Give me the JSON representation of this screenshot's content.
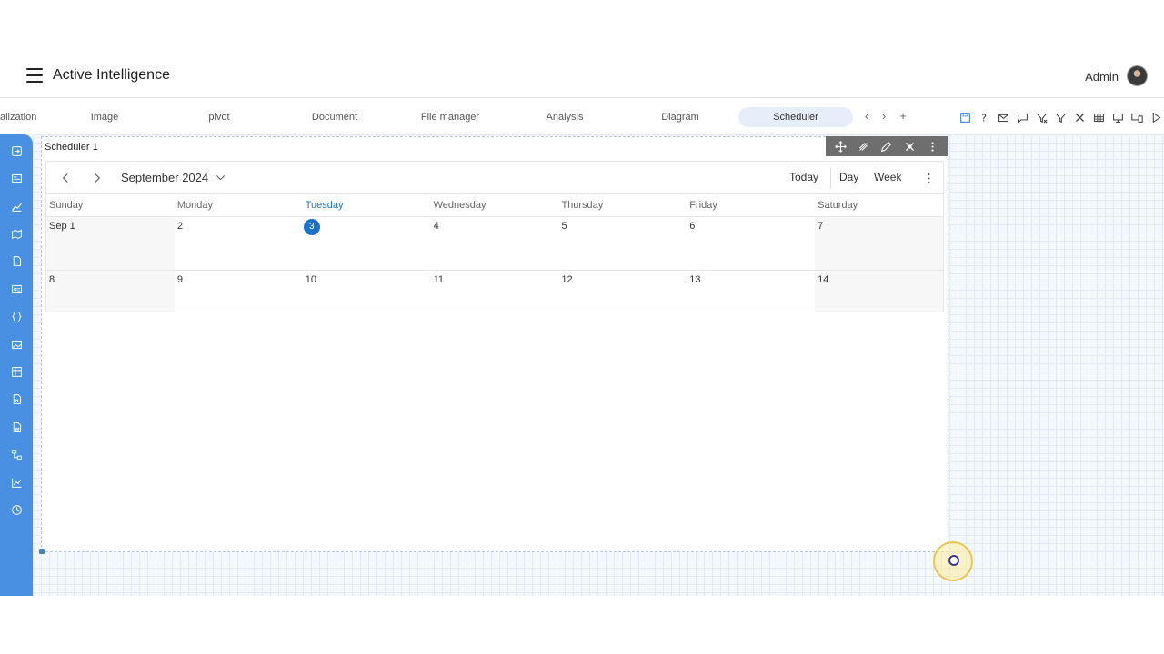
{
  "header": {
    "app_title": "Active Intelligence",
    "user_name": "Admin",
    "menu_icon": "hamburger-menu-icon",
    "avatar_icon": "user-avatar"
  },
  "tabs": [
    {
      "label": "alization",
      "active": false
    },
    {
      "label": "Image",
      "active": false
    },
    {
      "label": "pivot",
      "active": false
    },
    {
      "label": "Document",
      "active": false
    },
    {
      "label": "File manager",
      "active": false
    },
    {
      "label": "Analysis",
      "active": false
    },
    {
      "label": "Diagram",
      "active": false
    },
    {
      "label": "Scheduler",
      "active": true
    }
  ],
  "tab_controls": {
    "prev_icon": "chevron-left-icon",
    "next_icon": "chevron-right-icon",
    "add_icon": "plus-icon"
  },
  "toolbar_icons": [
    "save-icon",
    "help-icon",
    "mail-icon",
    "comment-icon",
    "clear-filter-icon",
    "filter-icon",
    "tools-icon",
    "table-icon",
    "screen-icon",
    "devices-icon",
    "play-icon"
  ],
  "sidebar_icons": [
    "login-icon",
    "news-icon",
    "chart-icon",
    "map-icon",
    "document-icon",
    "id-card-icon",
    "code-braces-icon",
    "image-icon",
    "pivot-icon",
    "excel-icon",
    "word-icon",
    "diagram-icon",
    "analysis-icon",
    "scheduler-icon"
  ],
  "widget": {
    "title": "Scheduler 1",
    "tool_icons": [
      "move-icon",
      "link-icon",
      "edit-icon",
      "settings-icon",
      "more-vertical-icon"
    ]
  },
  "scheduler": {
    "date_range": "September 2024",
    "views": {
      "today": "Today",
      "day": "Day",
      "week": "Week"
    },
    "day_names": [
      "Sunday",
      "Monday",
      "Tuesday",
      "Wednesday",
      "Thursday",
      "Friday",
      "Saturday"
    ],
    "today_index": 2,
    "weeks": [
      [
        "Sep 1",
        "2",
        "3",
        "4",
        "5",
        "6",
        "7"
      ],
      [
        "8",
        "9",
        "10",
        "11",
        "12",
        "13",
        "14"
      ]
    ]
  },
  "colors": {
    "accent": "#1a73c8",
    "sidebar": "#4a90e2",
    "active_tab": "#e6eef9",
    "widget_toolbar": "#6e6e6e"
  }
}
